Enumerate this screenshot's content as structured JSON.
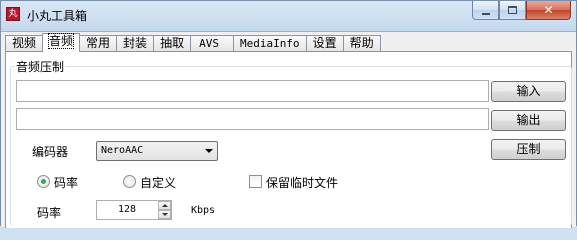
{
  "window": {
    "icon_text": "丸",
    "title": "小丸工具箱"
  },
  "tabs": [
    {
      "label": "视频",
      "active": false
    },
    {
      "label": "音频",
      "active": true
    },
    {
      "label": "常用",
      "active": false
    },
    {
      "label": "封装",
      "active": false
    },
    {
      "label": "抽取",
      "active": false
    },
    {
      "label": "AVS",
      "active": false
    },
    {
      "label": "MediaInfo",
      "active": false
    },
    {
      "label": "设置",
      "active": false
    },
    {
      "label": "帮助",
      "active": false
    }
  ],
  "audio": {
    "group_title": "音频压制",
    "input_path": "",
    "output_path": "",
    "input_button": "输入",
    "output_button": "输出",
    "encode_button": "压制",
    "encoder_label": "编码器",
    "encoder_value": "NeroAAC",
    "mode_bitrate_label": "码率",
    "mode_custom_label": "自定义",
    "keep_temp_label": "保留临时文件",
    "keep_temp_checked": false,
    "bitrate_label": "码率",
    "bitrate_value": "128",
    "bitrate_unit": "Kbps"
  }
}
